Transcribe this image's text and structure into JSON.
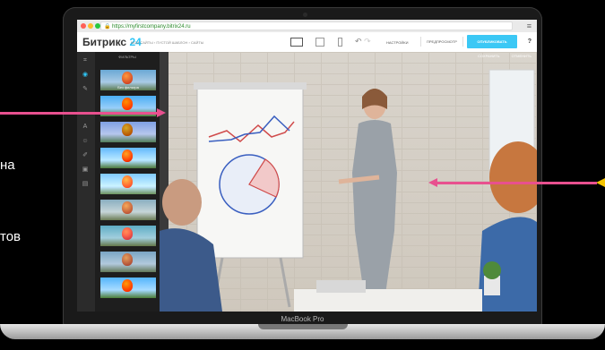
{
  "side_texts": [
    "на",
    "тов"
  ],
  "browser": {
    "url": "https://myfirstcompany.bitrix24.ru",
    "dot_colors": [
      "#ff5f57",
      "#febc2e",
      "#28c840"
    ]
  },
  "app": {
    "logo_main": "Битрикс",
    "logo_num": "24",
    "breadcrumbs": "МОИ САЙТЫ  ›  ПУСТОЙ ШАБЛОН  ›  САЙТЫ",
    "settings_label": "НАСТРОЙКИ",
    "preview_label": "ПРЕДПРОСМОТР",
    "publish_label": "ОПУБЛИКОВАТЬ",
    "help_label": "?",
    "accent_color": "#2fc6f6"
  },
  "panel": {
    "title": "ФИЛЬТРЫ",
    "thumbs": [
      {
        "label": "Без фильтра"
      },
      {
        "label": ""
      },
      {
        "label": ""
      },
      {
        "label": ""
      },
      {
        "label": ""
      },
      {
        "label": ""
      },
      {
        "label": ""
      },
      {
        "label": ""
      },
      {
        "label": ""
      }
    ]
  },
  "photo": {
    "save_label": "СОХРАНИТЬ",
    "cancel_label": "ОТМЕНИТЬ"
  },
  "device": {
    "model": "MacBook Pro"
  },
  "arrow_color": "#e8508f"
}
